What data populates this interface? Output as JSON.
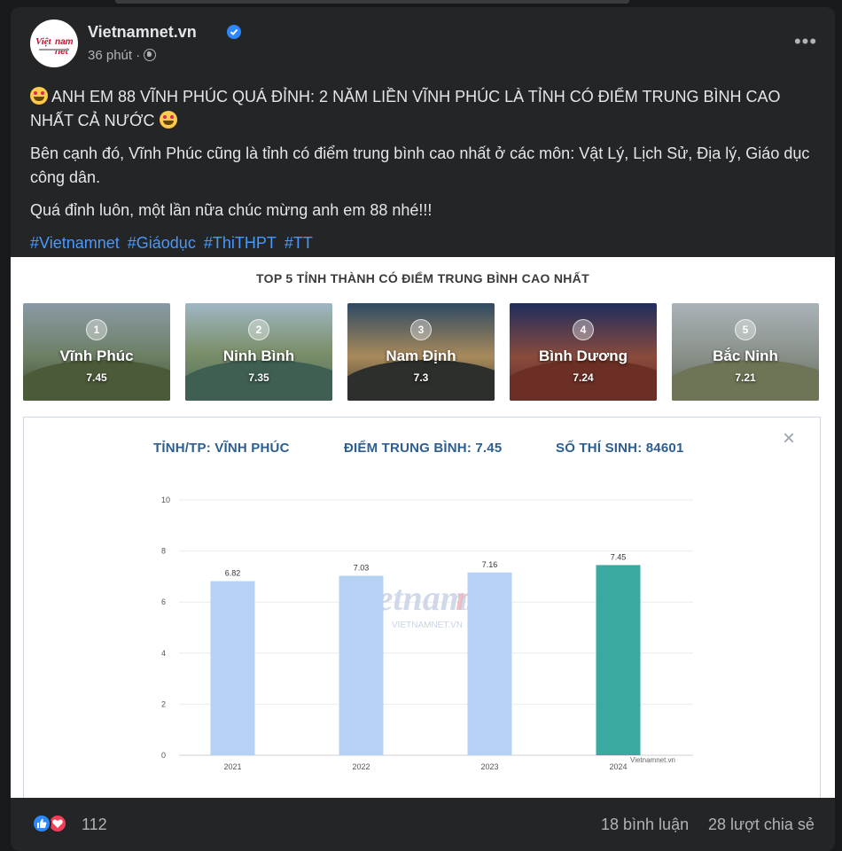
{
  "post": {
    "page_name": "Vietnamnet.vn",
    "time": "36 phút",
    "headline": "ANH EM 88 VĨNH PHÚC QUÁ ĐỈNH: 2 NĂM LIỀN VĨNH PHÚC LÀ TỈNH CÓ ĐIỂM TRUNG BÌNH CAO NHẤT CẢ NƯỚC",
    "paragraph1": "Bên cạnh đó, Vĩnh Phúc cũng là tỉnh có điểm trung bình cao nhất ở các môn: Vật Lý, Lịch Sử, Địa lý, Giáo dục công dân.",
    "paragraph2": "Quá đỉnh luôn, một lần nữa chúc mừng anh em 88 nhé!!!",
    "hashtags": [
      "#Vietnamnet",
      "#Giáodục",
      "#ThiTHPT",
      "#TT"
    ],
    "avatar_logo_a": "Việt",
    "avatar_logo_b": "nam net"
  },
  "infographic": {
    "title": "TOP 5 TỈNH THÀNH CÓ ĐIỂM TRUNG BÌNH CAO NHẤT",
    "cards": [
      {
        "rank": "1",
        "name": "Vĩnh Phúc",
        "score": "7.45"
      },
      {
        "rank": "2",
        "name": "Ninh Bình",
        "score": "7.35"
      },
      {
        "rank": "3",
        "name": "Nam Định",
        "score": "7.3"
      },
      {
        "rank": "4",
        "name": "Bình Dương",
        "score": "7.24"
      },
      {
        "rank": "5",
        "name": "Bắc Ninh",
        "score": "7.21"
      }
    ],
    "panel": {
      "province": "TỈNH/TP: VĨNH PHÚC",
      "average": "ĐIỂM TRUNG BÌNH: 7.45",
      "candidates": "SỐ THÍ SINH: 84601"
    },
    "source": "Vietnamnet.vn",
    "watermark_a": "Vietnam",
    "watermark_b": "net",
    "watermark_url": "VIETNAMNET.VN"
  },
  "chart_data": {
    "type": "bar",
    "categories": [
      "2021",
      "2022",
      "2023",
      "2024"
    ],
    "values": [
      6.82,
      7.03,
      7.16,
      7.45
    ],
    "ylim": [
      0,
      10
    ],
    "yticks": [
      0,
      2,
      4,
      6,
      8,
      10
    ],
    "grid": true,
    "colors": [
      "#b5d1f5",
      "#b5d1f5",
      "#b5d1f5",
      "#3aa99f"
    ]
  },
  "footer": {
    "reaction_count": "112",
    "comments": "18 bình luận",
    "shares": "28 lượt chia sẻ"
  },
  "colors": {
    "background": "#18191a",
    "card": "#242526",
    "hashtag": "#4599ff",
    "panel_heading": "#2d5e8f"
  }
}
